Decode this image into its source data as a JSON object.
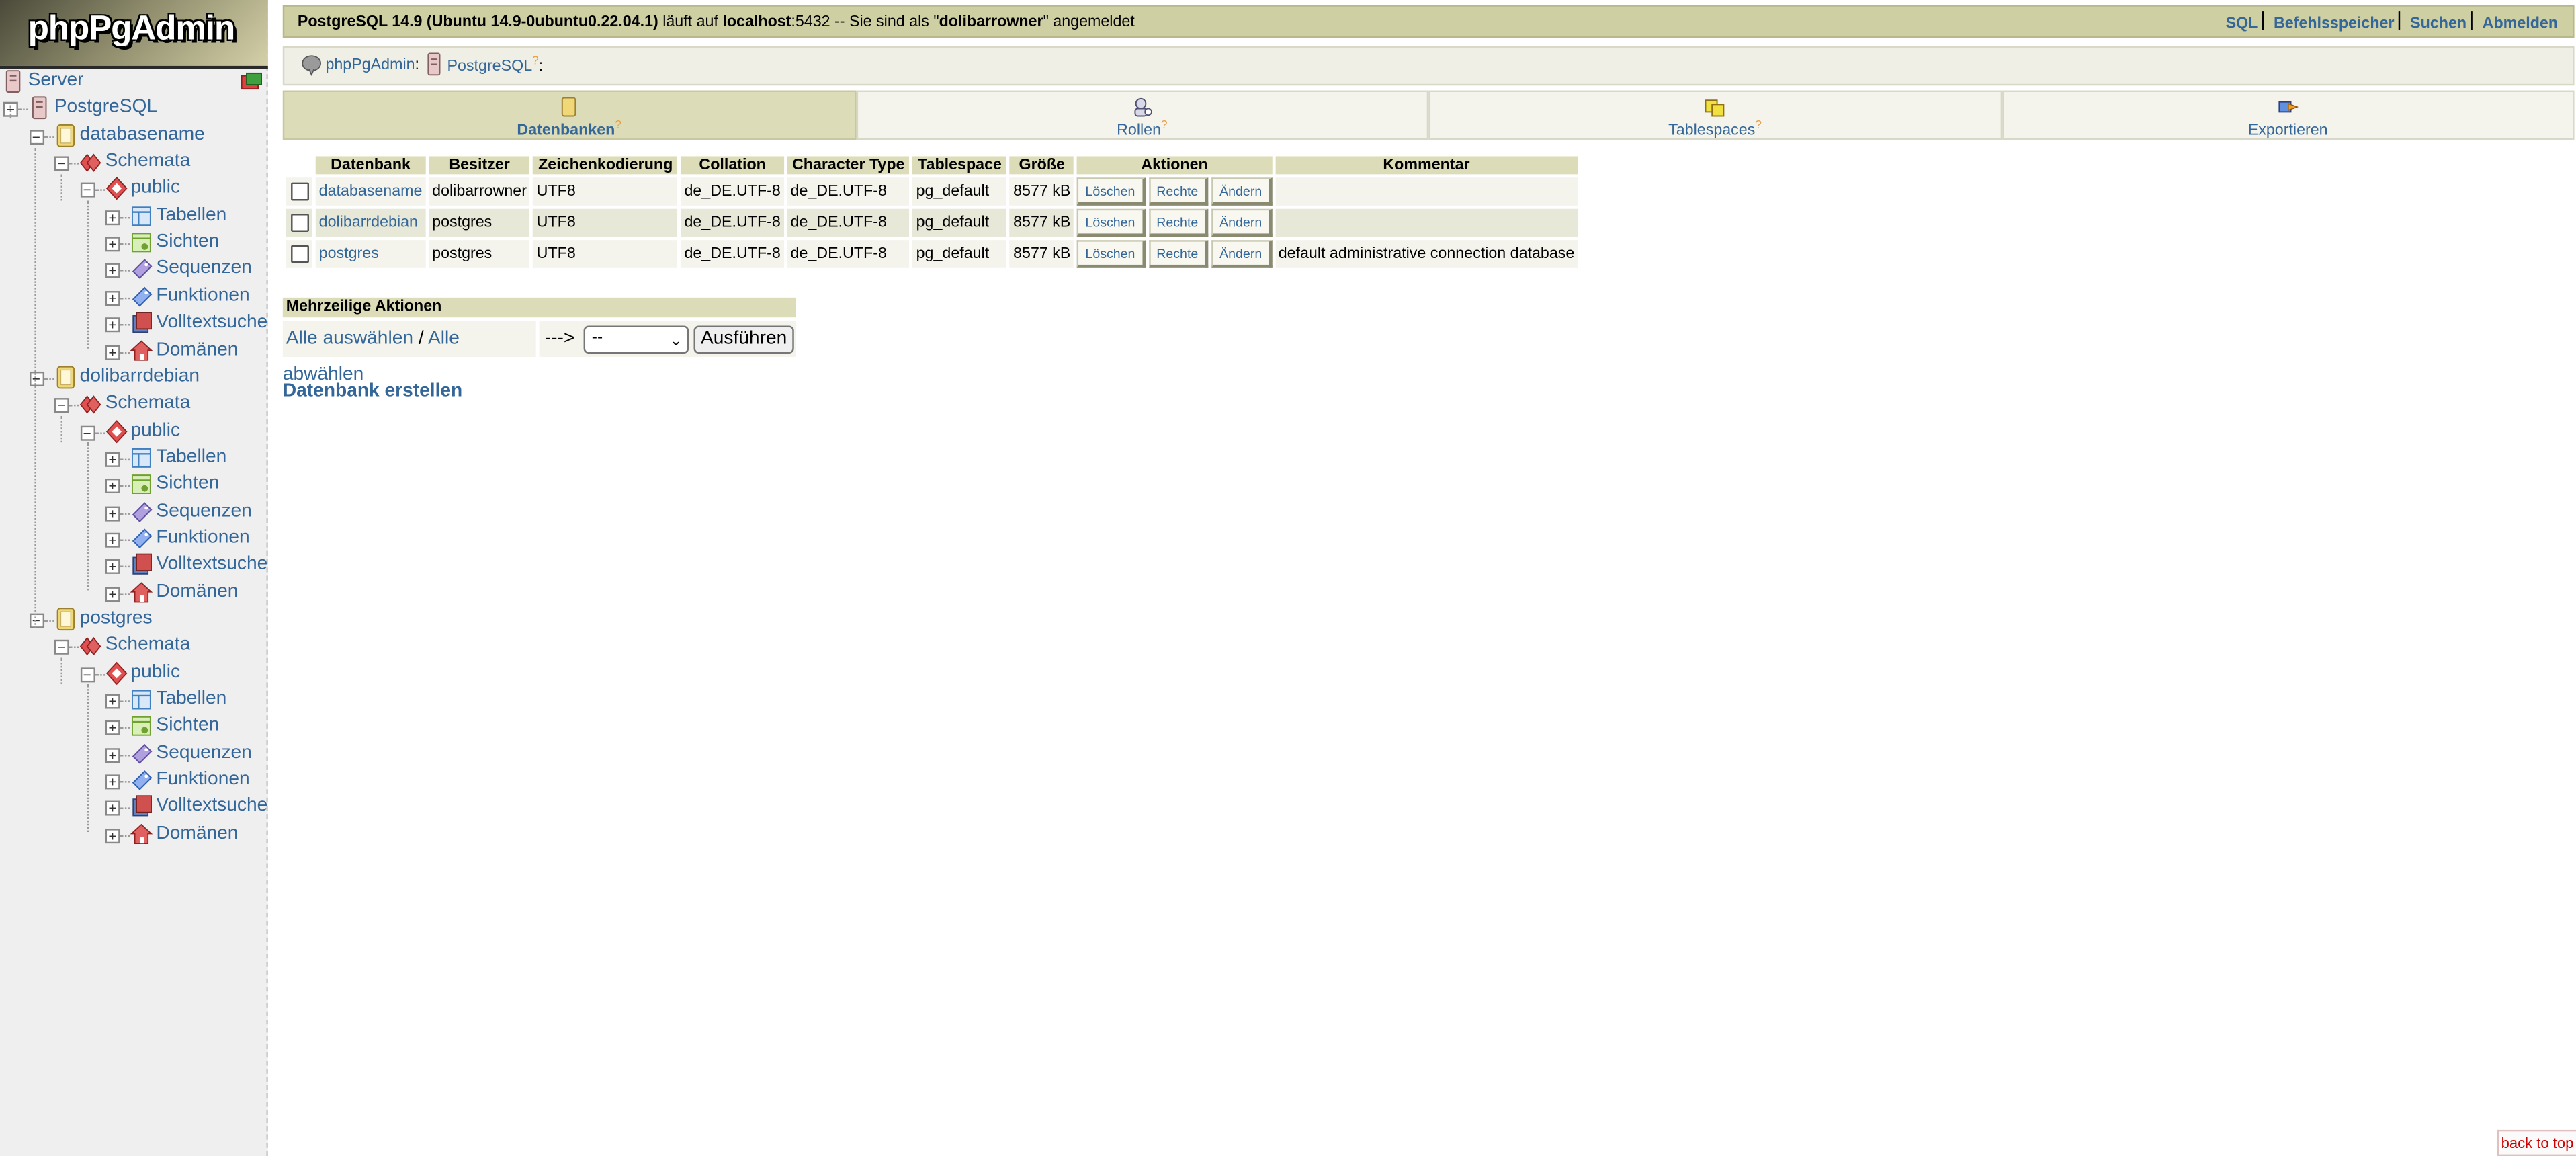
{
  "logo": {
    "text": "phpPgAdmin"
  },
  "tree": {
    "server": "Server",
    "postgresql": "PostgreSQL",
    "databases": [
      {
        "name": "databasename",
        "schemata": "Schemata",
        "schema": "public",
        "children": [
          "Tabellen",
          "Sichten",
          "Sequenzen",
          "Funktionen",
          "Volltextsuche",
          "Domänen"
        ]
      },
      {
        "name": "dolibarrdebian",
        "schemata": "Schemata",
        "schema": "public",
        "children": [
          "Tabellen",
          "Sichten",
          "Sequenzen",
          "Funktionen",
          "Volltextsuche",
          "Domänen"
        ]
      },
      {
        "name": "postgres",
        "schemata": "Schemata",
        "schema": "public",
        "children": [
          "Tabellen",
          "Sichten",
          "Sequenzen",
          "Funktionen",
          "Volltextsuche",
          "Domänen"
        ]
      }
    ]
  },
  "topbar": {
    "version": "PostgreSQL 14.9 (Ubuntu 14.9-0ubuntu0.22.04.1)",
    "runs_on": " läuft auf ",
    "host": "localhost",
    "port_text": ":5432 -- Sie sind als \"",
    "user": "dolibarrowner",
    "logged_in": "\" angemeldet",
    "links": {
      "sql": "SQL",
      "history": "Befehlsspeicher",
      "search": "Suchen",
      "logout": "Abmelden"
    }
  },
  "trail": {
    "app": "phpPgAdmin",
    "server": "PostgreSQL",
    "help": "?",
    "colon": ":"
  },
  "tabs": [
    {
      "label": "Datenbanken",
      "help": "?"
    },
    {
      "label": "Rollen",
      "help": "?"
    },
    {
      "label": "Tablespaces",
      "help": "?"
    },
    {
      "label": "Exportieren",
      "help": ""
    }
  ],
  "table": {
    "headers": [
      "Datenbank",
      "Besitzer",
      "Zeichenkodierung",
      "Collation",
      "Character Type",
      "Tablespace",
      "Größe",
      "Aktionen",
      "Kommentar"
    ],
    "actions": [
      "Löschen",
      "Rechte",
      "Ändern"
    ],
    "rows": [
      {
        "db": "databasename",
        "owner": "dolibarrowner",
        "encoding": "UTF8",
        "collation": "de_DE.UTF-8",
        "ctype": "de_DE.UTF-8",
        "tablespace": "pg_default",
        "size": "8577 kB",
        "comment": ""
      },
      {
        "db": "dolibarrdebian",
        "owner": "postgres",
        "encoding": "UTF8",
        "collation": "de_DE.UTF-8",
        "ctype": "de_DE.UTF-8",
        "tablespace": "pg_default",
        "size": "8577 kB",
        "comment": ""
      },
      {
        "db": "postgres",
        "owner": "postgres",
        "encoding": "UTF8",
        "collation": "de_DE.UTF-8",
        "ctype": "de_DE.UTF-8",
        "tablespace": "pg_default",
        "size": "8577 kB",
        "comment": "default administrative connection database"
      }
    ]
  },
  "multi": {
    "title": "Mehrzeilige Aktionen",
    "select_all": "Alle auswählen",
    "slash": "/",
    "deselect_all": "Alle abwählen",
    "arrow": "--->",
    "select_value": "--",
    "execute": "Ausführen"
  },
  "create_db": "Datenbank erstellen",
  "back_to_top": "back to top",
  "colors": {
    "link": "#336699",
    "header_bg": "#dcdcb8",
    "row_a": "#f4f4ec",
    "row_b": "#e8e8d8",
    "topbar": "#cfcfa4"
  }
}
